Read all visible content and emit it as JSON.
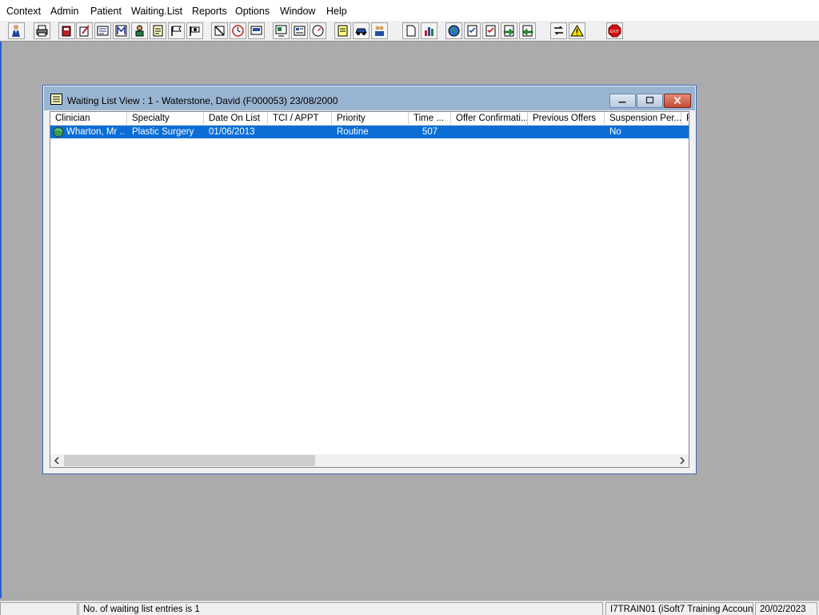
{
  "menu": [
    "Context",
    "Admin",
    "Patient",
    "Waiting.List",
    "Reports",
    "Options",
    "Window",
    "Help"
  ],
  "toolbar_icons": [
    "person-search-icon",
    "printer-icon",
    "book-icon",
    "edit-note-icon",
    "document-list-icon",
    "letter-m-icon",
    "patient-icon",
    "note-pad-icon",
    "flag-icon",
    "flag-open-icon",
    "cancel-document-icon",
    "clock-icon",
    "monitor-icon",
    "report-screen-icon",
    "list-form-icon",
    "dial-icon",
    "notes-icon",
    "car-icon",
    "people-list-icon",
    "blank-page-icon",
    "bar-chart-icon",
    "globe-icon",
    "checklist-icon",
    "checklist-edit-icon",
    "green-arrow-in-icon",
    "green-arrow-out-icon",
    "transfer-icon",
    "warning-icon",
    "exit-icon"
  ],
  "window": {
    "title": "Waiting List View :  1 - Waterstone, David (F000053) 23/08/2000",
    "columns": [
      "Clinician",
      "Specialty",
      "Date On List",
      "TCI / APPT",
      "Priority",
      "Time ...",
      "Offer Confirmati...",
      "Previous Offers",
      "Suspension Per...",
      "F"
    ],
    "rows": [
      {
        "clinician": "Wharton, Mr ...",
        "specialty": "Plastic Surgery",
        "date_on_list": "01/06/2013",
        "tci_appt": "",
        "priority": "Routine",
        "time": "507",
        "offer_confirmation": "",
        "previous_offers": "",
        "suspension": "No"
      }
    ]
  },
  "status": {
    "message": "No. of waiting list entries is 1",
    "account": "I7TRAIN01 (iSoft7 Training Account)",
    "date": "20/02/2023"
  },
  "colors": {
    "selection": "#0a6ed6",
    "titlebar": "#99b4d1",
    "desktop": "#ababab"
  }
}
